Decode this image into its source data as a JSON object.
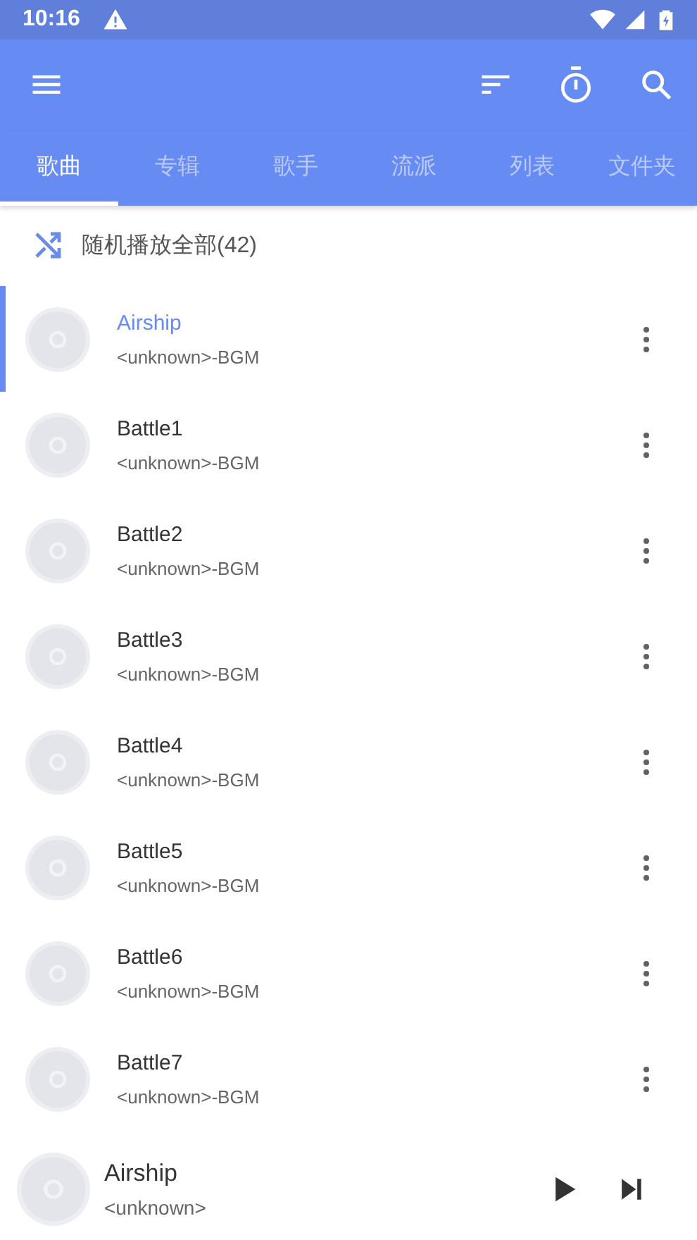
{
  "status_bar": {
    "time": "10:16"
  },
  "tabs": [
    {
      "label": "歌曲",
      "selected": true
    },
    {
      "label": "专辑",
      "selected": false
    },
    {
      "label": "歌手",
      "selected": false
    },
    {
      "label": "流派",
      "selected": false
    },
    {
      "label": "列表",
      "selected": false
    },
    {
      "label": "文件夹",
      "selected": false
    }
  ],
  "shuffle": {
    "label": "随机播放全部(42)"
  },
  "songs": [
    {
      "title": "Airship",
      "subtitle": "<unknown>-BGM",
      "selected": true
    },
    {
      "title": "Battle1",
      "subtitle": "<unknown>-BGM",
      "selected": false
    },
    {
      "title": "Battle2",
      "subtitle": "<unknown>-BGM",
      "selected": false
    },
    {
      "title": "Battle3",
      "subtitle": "<unknown>-BGM",
      "selected": false
    },
    {
      "title": "Battle4",
      "subtitle": "<unknown>-BGM",
      "selected": false
    },
    {
      "title": "Battle5",
      "subtitle": "<unknown>-BGM",
      "selected": false
    },
    {
      "title": "Battle6",
      "subtitle": "<unknown>-BGM",
      "selected": false
    },
    {
      "title": "Battle7",
      "subtitle": "<unknown>-BGM",
      "selected": false
    }
  ],
  "now_playing": {
    "title": "Airship",
    "subtitle": "<unknown>"
  }
}
